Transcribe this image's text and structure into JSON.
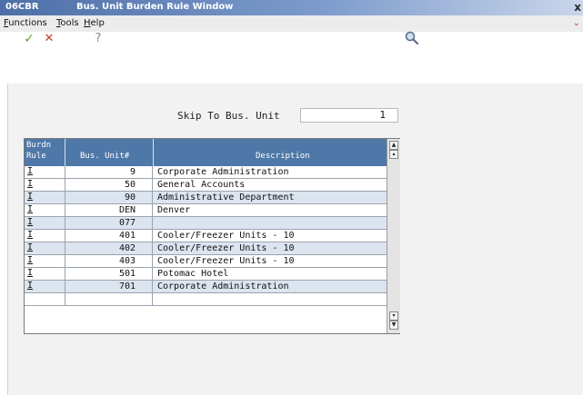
{
  "window": {
    "app_id": "06CBR",
    "title": "Bus. Unit Burden Rule Window",
    "close_glyph": "x"
  },
  "menu": {
    "items": [
      {
        "label": "Functions",
        "mnemonic": "F"
      },
      {
        "label": "Tools",
        "mnemonic": "T"
      },
      {
        "label": "Help",
        "mnemonic": "H"
      }
    ]
  },
  "toolbar": {
    "ok_icon": "checkmark-icon",
    "cancel_icon": "cancel-x-icon",
    "help_glyph": "?",
    "search_icon": "magnifier-icon",
    "colors": {
      "ok": "#6a9c3a",
      "cancel": "#c33b2e"
    }
  },
  "skip": {
    "label": "Skip To Bus. Unit",
    "value": "1"
  },
  "grid": {
    "headers": {
      "burden_rule_line1": "Burdn",
      "burden_rule_line2": "Rule",
      "bus_unit": "Bus. Unit#",
      "description": "Description"
    },
    "header_color": "#4e78a8",
    "rows": [
      {
        "rule": "I",
        "bu": "9",
        "desc": "Corporate Administration"
      },
      {
        "rule": "I",
        "bu": "50",
        "desc": "General Accounts"
      },
      {
        "rule": "I",
        "bu": "90",
        "desc": "Administrative Department"
      },
      {
        "rule": "I",
        "bu": "DEN",
        "desc": "Denver"
      },
      {
        "rule": "I",
        "bu": "077",
        "desc": ""
      },
      {
        "rule": "I",
        "bu": "401",
        "desc": "Cooler/Freezer Units - 10"
      },
      {
        "rule": "I",
        "bu": "402",
        "desc": "Cooler/Freezer Units - 10"
      },
      {
        "rule": "I",
        "bu": "403",
        "desc": "Cooler/Freezer Units - 10"
      },
      {
        "rule": "I",
        "bu": "501",
        "desc": "Potomac Hotel"
      },
      {
        "rule": "I",
        "bu": "701",
        "desc": "Corporate Administration"
      },
      {
        "rule": "",
        "bu": "",
        "desc": ""
      }
    ]
  }
}
